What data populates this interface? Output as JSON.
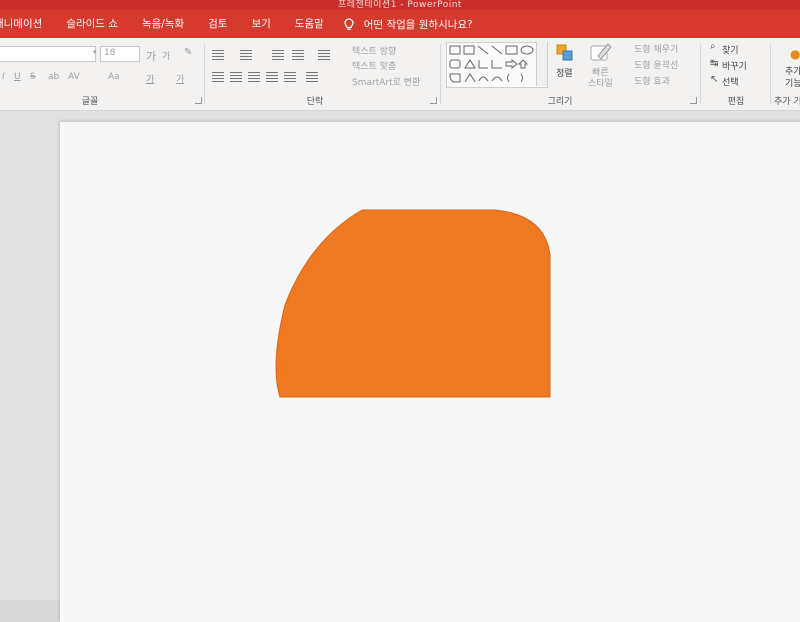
{
  "window": {
    "title": "프레젠테이션1  -  PowerPoint"
  },
  "tabs": [
    {
      "label": "애니메이션"
    },
    {
      "label": "슬라이드 쇼"
    },
    {
      "label": "녹음/녹화"
    },
    {
      "label": "검토"
    },
    {
      "label": "보기"
    },
    {
      "label": "도움말"
    }
  ],
  "tell_me": {
    "placeholder": "어떤 작업을 원하시나요?",
    "icon": "lightbulb-icon"
  },
  "font_group": {
    "label": "글꼴",
    "font_size": "18",
    "grow_label": "가",
    "shrink_label": "가",
    "case_label": "Aa",
    "color_label": "가",
    "highlight_label": "가"
  },
  "paragraph_group": {
    "label": "단락",
    "text_direction": "텍스트 방향",
    "align_text": "텍스트 맞춤",
    "smartart": "SmartArt로 변환"
  },
  "drawing_group": {
    "label": "그리기",
    "arrange": "정렬",
    "quick_styles": "빠른\n스타일",
    "shape_fill": "도형 채우기",
    "shape_outline": "도형 윤곽선",
    "shape_effects": "도형 효과"
  },
  "editing_group": {
    "label": "편집",
    "find": "찾기",
    "replace": "바꾸기",
    "select": "선택"
  },
  "addins_group": {
    "label": "추가 기",
    "button": "추가\n기능"
  },
  "slide": {
    "shape_color": "#f07a22",
    "shape_outline": "#d9671a",
    "background": "#f7f7f7"
  },
  "colors": {
    "ribbon_tabs": "#d63a2f",
    "title_bar": "#c9302b",
    "ribbon_body": "#f3f2f1"
  }
}
